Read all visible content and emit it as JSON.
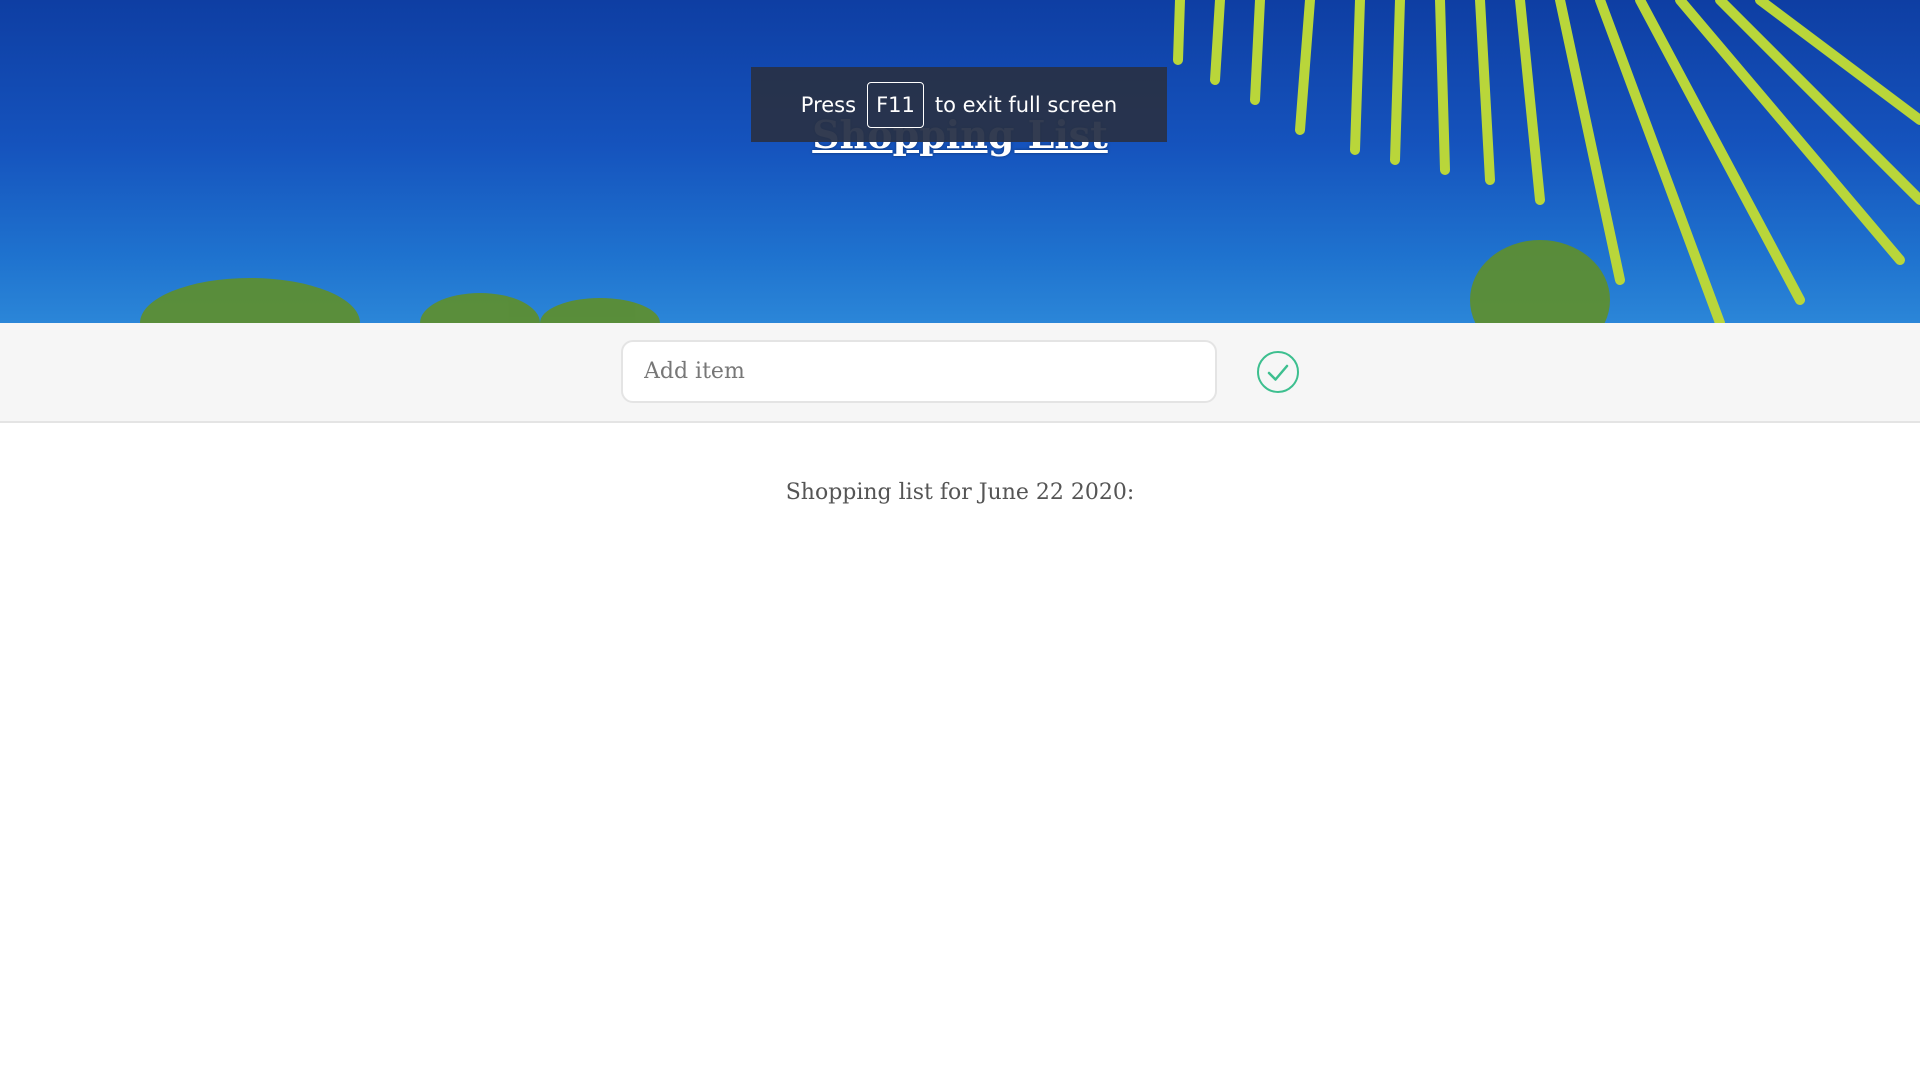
{
  "header": {
    "title": "Shopping List"
  },
  "fullscreen_notice": {
    "prefix": "Press",
    "key": "F11",
    "suffix": "to exit full screen"
  },
  "add_bar": {
    "input_placeholder": "Add item",
    "input_value": "",
    "submit_icon": "check-circle-icon",
    "accent_color": "#3dbf8f"
  },
  "main": {
    "list_heading": "Shopping list for June 22 2020:"
  }
}
